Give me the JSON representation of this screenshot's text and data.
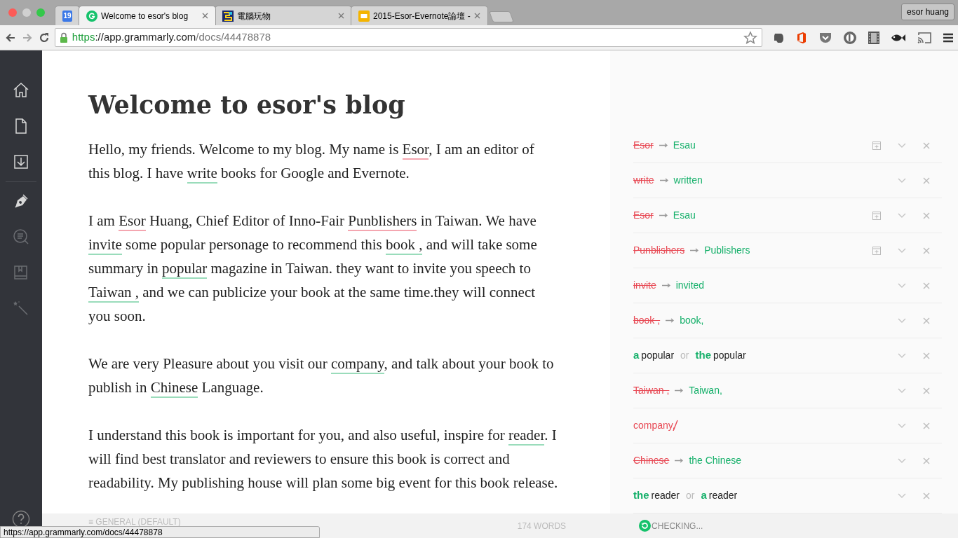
{
  "browser": {
    "tabs": [
      {
        "kind": "calendar",
        "label": "19",
        "selected": false
      },
      {
        "kind": "g-logo",
        "label": "Welcome to esor's blog",
        "selected": true
      },
      {
        "kind": "pixel",
        "label": "電腦玩物",
        "selected": false
      },
      {
        "kind": "slides",
        "label": "2015-Esor-Evernote論壇 -",
        "selected": false
      }
    ],
    "profile": "esor huang",
    "url": {
      "scheme": "https",
      "host": "://app.grammarly.com",
      "path": "/docs/44478878"
    }
  },
  "sidebar": {
    "items": [
      {
        "disabled": false
      },
      {
        "disabled": false
      },
      {
        "disabled": false
      },
      {
        "disabled": false
      },
      {
        "disabled": true
      },
      {
        "disabled": true
      },
      {
        "disabled": true
      }
    ]
  },
  "document": {
    "title": "Welcome to esor's blog",
    "paragraphs": [
      [
        {
          "kind": "plain",
          "text": "Hello, my friends. Welcome to my blog. My name is "
        },
        {
          "kind": "spelling",
          "text": "Esor"
        },
        {
          "kind": "plain",
          "text": ", I am an editor of this blog. I have "
        },
        {
          "kind": "grammar",
          "text": "write"
        },
        {
          "kind": "plain",
          "text": " books for Google and Evernote."
        }
      ],
      [
        {
          "kind": "plain",
          "text": "I am "
        },
        {
          "kind": "spelling",
          "text": "Esor"
        },
        {
          "kind": "plain",
          "text": " Huang, Chief Editor of Inno-Fair "
        },
        {
          "kind": "spelling",
          "text": "Punblishers"
        },
        {
          "kind": "plain",
          "text": " in Taiwan. We have "
        },
        {
          "kind": "grammar",
          "text": "invite"
        },
        {
          "kind": "plain",
          "text": " some popular personage to recommend this "
        },
        {
          "kind": "grammar",
          "text": "book ,"
        },
        {
          "kind": "plain",
          "text": " and will take some summary in "
        },
        {
          "kind": "grammar",
          "text": "popular"
        },
        {
          "kind": "plain",
          "text": " magazine in Taiwan.  they want to invite you speech to "
        },
        {
          "kind": "grammar",
          "text": "Taiwan ,"
        },
        {
          "kind": "plain",
          "text": " and we can publicize your book at the same time.they will connect you soon."
        }
      ],
      [
        {
          "kind": "plain",
          "text": "We are very Pleasure about you visit our "
        },
        {
          "kind": "grammar",
          "text": "company"
        },
        {
          "kind": "plain",
          "text": ", and talk about your book to publish in "
        },
        {
          "kind": "grammar",
          "text": "Chinese"
        },
        {
          "kind": "plain",
          "text": " Language."
        }
      ],
      [
        {
          "kind": "plain",
          "text": "I understand this book is important for you, and also useful, inspire for "
        },
        {
          "kind": "grammar",
          "text": "reader"
        },
        {
          "kind": "plain",
          "text": ". I will find best translator and reviewers to ensure this book is correct and readability. My publishing house will plan some big event for this book release."
        }
      ]
    ]
  },
  "suggestions": [
    {
      "kind": "replace",
      "old": "Esor",
      "new": "Esau",
      "dictionary": true
    },
    {
      "kind": "replace",
      "old": "write",
      "new": "written",
      "dictionary": false
    },
    {
      "kind": "replace",
      "old": "Esor",
      "new": "Esau",
      "dictionary": true
    },
    {
      "kind": "replace",
      "old": "Punblishers",
      "new": "Publishers",
      "dictionary": true
    },
    {
      "kind": "replace",
      "old": "invite",
      "new": "invited",
      "dictionary": false
    },
    {
      "kind": "replace",
      "old": "book ,",
      "new": "book,",
      "dictionary": false
    },
    {
      "kind": "choice",
      "options": [
        {
          "article": "a",
          "word": "popular"
        },
        {
          "article": "the",
          "word": "popular"
        }
      ],
      "separator": "or",
      "dictionary": false
    },
    {
      "kind": "replace",
      "old": "Taiwan ,",
      "new": "Taiwan,",
      "dictionary": false
    },
    {
      "kind": "remove",
      "text": "company",
      "removed": ",",
      "dictionary": false
    },
    {
      "kind": "replace",
      "old": "Chinese",
      "new": "the Chinese",
      "dictionary": false
    },
    {
      "kind": "choice",
      "options": [
        {
          "article": "the",
          "word": "reader"
        },
        {
          "article": "a",
          "word": "reader"
        }
      ],
      "separator": "or",
      "dictionary": false
    }
  ],
  "footer": {
    "style_label": "≡ GENERAL (DEFAULT)",
    "word_count": "174 WORDS",
    "status": "CHECKING..."
  },
  "status_url": "https://app.grammarly.com/docs/44478878"
}
